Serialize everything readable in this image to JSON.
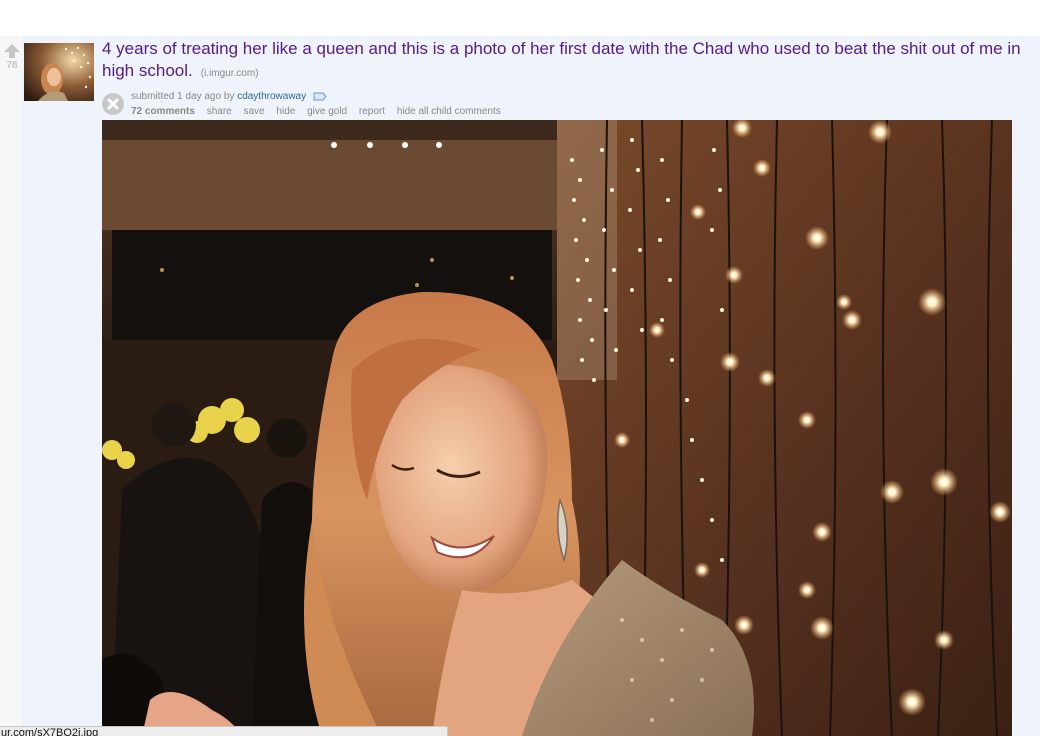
{
  "post": {
    "score": "78",
    "title": "4 years of treating her like a queen and this is a photo of her first date with the Chad who used to beat the shit out of me in high school.",
    "domain": "(i.imgur.com)",
    "submitted_prefix": "submitted 1 day ago by",
    "author": "cdaythrowaway",
    "buttons": {
      "comments": "72 comments",
      "share": "share",
      "save": "save",
      "hide": "hide",
      "give_gold": "give gold",
      "report": "report",
      "hide_child": "hide all child comments"
    }
  },
  "status_bar": {
    "url": "ur.com/sX7BQ2i.jpg"
  },
  "icons": {
    "upvote": "arrow-up-icon",
    "expando": "close-icon",
    "flair": "tag-icon"
  },
  "colors": {
    "title_visited": "#551a8b",
    "author": "#336699",
    "thing_background": "#eff3fb",
    "muted_text": "#888888"
  }
}
